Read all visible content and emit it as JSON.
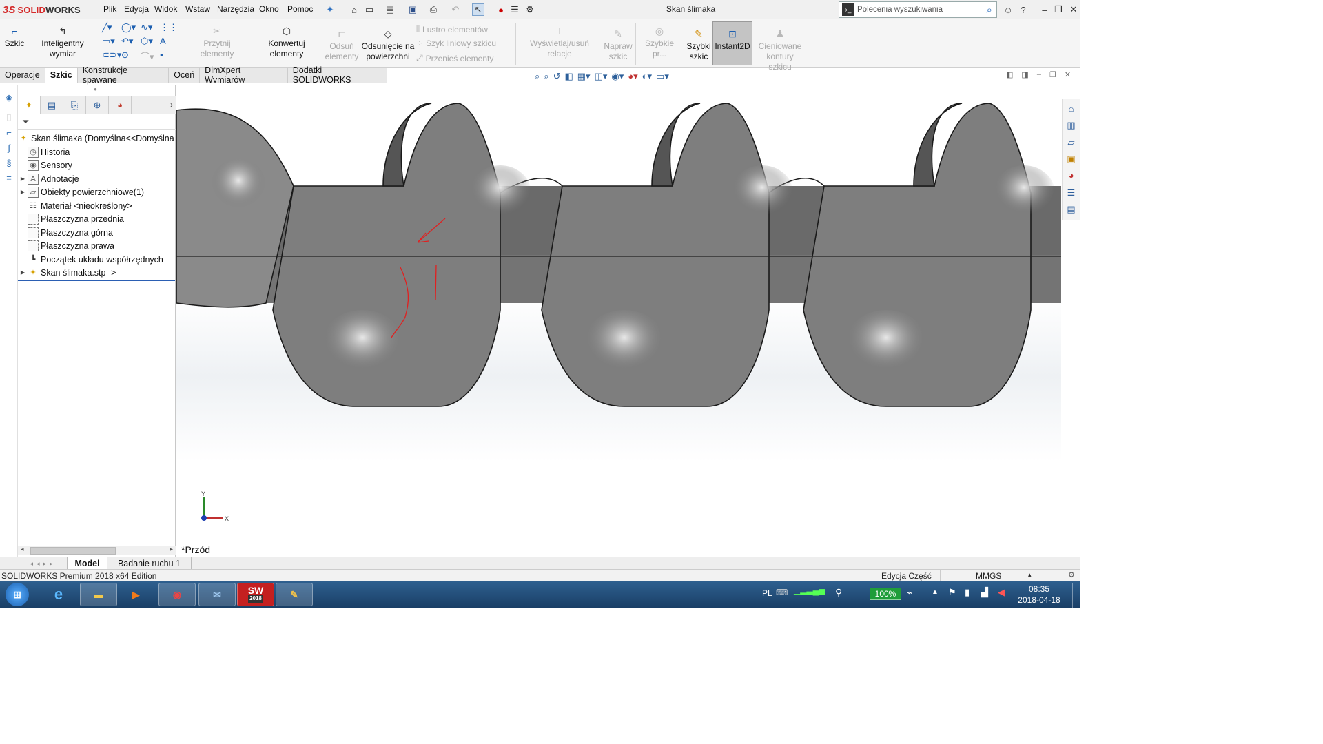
{
  "app": {
    "logo_prefix": "SOLID",
    "logo_suffix": "WORKS",
    "window_title": "Skan ślimaka"
  },
  "menu": [
    "Plik",
    "Edycja",
    "Widok",
    "Wstaw",
    "Narzędzia",
    "Okno",
    "Pomoc"
  ],
  "search": {
    "placeholder": "Polecenia wyszukiwania"
  },
  "commands": {
    "sketch": "Szkic",
    "smart_dimension": "Inteligentny wymiar",
    "trim": "Przytnij elementy",
    "convert": "Konwertuj elementy",
    "offset_1": "Odsuń",
    "offset_2": "elementy",
    "offset_surface_1": "Odsunięcie na",
    "offset_surface_2": "powierzchni",
    "mirror": "Lustro elementów",
    "linear_pattern": "Szyk liniowy szkicu",
    "move": "Przenieś elementy",
    "relations": "Wyświetlaj/usuń relacje",
    "repair_1": "Napraw",
    "repair_2": "szkic",
    "quick_snaps": "Szybkie pr...",
    "rapid_sketch_1": "Szybki",
    "rapid_sketch_2": "szkic",
    "instant2d": "Instant2D",
    "shaded_1": "Cieniowane",
    "shaded_2": "kontury szkicu"
  },
  "tabs": [
    {
      "label": "Operacje",
      "active": false
    },
    {
      "label": "Szkic",
      "active": true
    },
    {
      "label": "Konstrukcje spawane",
      "active": false
    },
    {
      "label": "Oceń",
      "active": false
    },
    {
      "label": "DimXpert Wymiarów",
      "active": false
    },
    {
      "label": "Dodatki SOLIDWORKS",
      "active": false
    }
  ],
  "tree": {
    "root": "Skan ślimaka  (Domyślna<<Domyślna",
    "items": [
      {
        "label": "Historia",
        "expandable": false
      },
      {
        "label": "Sensory",
        "expandable": false
      },
      {
        "label": "Adnotacje",
        "expandable": true
      },
      {
        "label": "Obiekty powierzchniowe(1)",
        "expandable": true
      },
      {
        "label": "Materiał <nieokreślony>",
        "expandable": false
      },
      {
        "label": "Płaszczyzna przednia",
        "expandable": false
      },
      {
        "label": "Płaszczyzna górna",
        "expandable": false
      },
      {
        "label": "Płaszczyzna prawa",
        "expandable": false
      },
      {
        "label": "Początek układu współrzędnych",
        "expandable": false
      },
      {
        "label": "Skan ślimaka.stp ->",
        "expandable": true
      }
    ]
  },
  "viewport": {
    "view_name": "*Przód",
    "axis_x": "X",
    "axis_y": "Y"
  },
  "bottom_tabs": {
    "model": "Model",
    "motion": "Badanie ruchu 1"
  },
  "status": {
    "edition": "SOLIDWORKS Premium 2018 x64 Edition",
    "mode": "Edycja Część",
    "units": "MMGS"
  },
  "taskbar": {
    "lang": "PL",
    "battery": "100%",
    "time": "08:35",
    "date": "2018-04-18",
    "sw_badge": "2018"
  },
  "colors": {
    "accent": "#1c5fb0",
    "logo_red": "#d42a2a",
    "taskbar": "#1f4a75",
    "model_shade": "#7f7f7f"
  }
}
